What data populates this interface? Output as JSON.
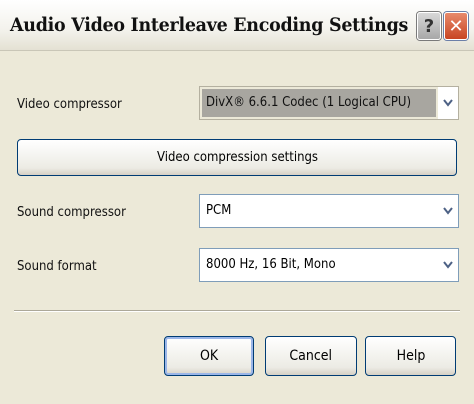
{
  "window": {
    "title": "Audio Video Interleave Encoding Settings",
    "help_glyph": "?",
    "close_glyph": "✕"
  },
  "fields": {
    "video_compressor": {
      "label": "Video compressor",
      "value": "DivX® 6.6.1 Codec (1 Logical CPU)"
    },
    "sound_compressor": {
      "label": "Sound compressor",
      "value": "PCM"
    },
    "sound_format": {
      "label": "Sound format",
      "value": "8000 Hz, 16 Bit, Mono"
    }
  },
  "buttons": {
    "video_settings": "Video compression settings",
    "ok": "OK",
    "cancel": "Cancel",
    "help": "Help"
  },
  "icons": [
    "help-icon",
    "close-icon",
    "chevron-down-icon"
  ],
  "colors": {
    "titlebar": "#f3f2ec",
    "dialog": "#ece9d8",
    "close_button": "#c84523",
    "field_border": "#7f9db9"
  }
}
